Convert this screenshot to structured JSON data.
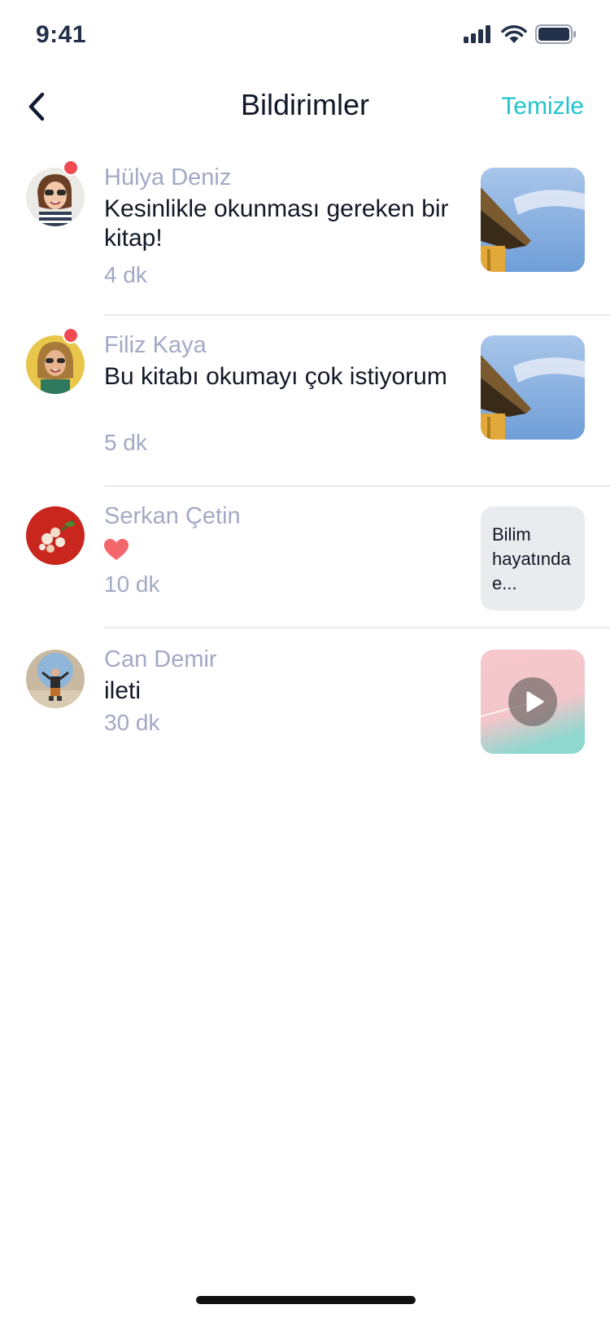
{
  "status_bar": {
    "time": "9:41"
  },
  "header": {
    "title": "Bildirimler",
    "clear_label": "Temizle"
  },
  "notifications": [
    {
      "name": "Hülya Deniz",
      "message": "Kesinlikle okunması gereken bir kitap!",
      "time": "4 dk",
      "unread": true,
      "preview": "image"
    },
    {
      "name": "Filiz Kaya",
      "message": "Bu kitabı okumayı çok istiyorum",
      "time": "5 dk",
      "unread": true,
      "preview": "image"
    },
    {
      "name": "Serkan Çetin",
      "message": "",
      "icon": "heart-icon",
      "time": "10 dk",
      "unread": false,
      "preview": "text",
      "preview_text": "Bilim hayatında e..."
    },
    {
      "name": "Can Demir",
      "message": "ileti",
      "time": "30 dk",
      "unread": false,
      "preview": "video"
    }
  ],
  "colors": {
    "accent": "#22C3CF",
    "unread": "#F24A52",
    "secondary_text": "#A3A9C5",
    "heart": "#F3666C"
  }
}
